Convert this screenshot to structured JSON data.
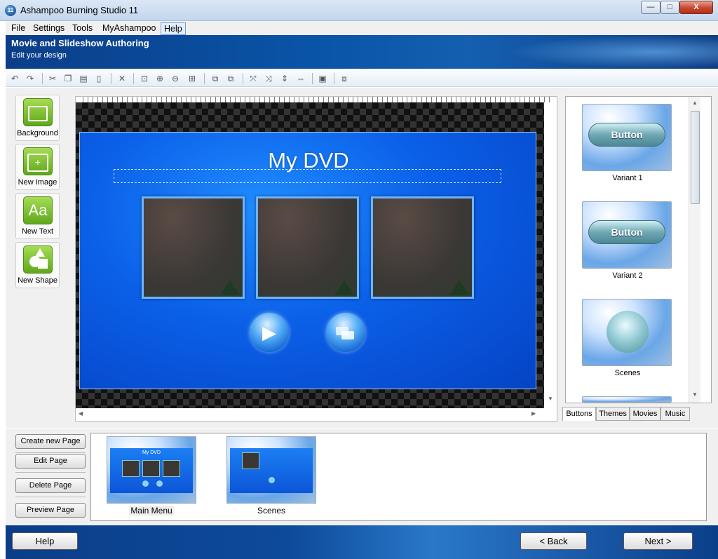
{
  "window": {
    "title": "Ashampoo Burning Studio 11",
    "app_icon_text": "11",
    "minimize_glyph": "—",
    "maximize_glyph": "□",
    "close_glyph": "X"
  },
  "menu": [
    "File",
    "Settings",
    "Tools",
    "MyAshampoo",
    "Help"
  ],
  "header": {
    "title": "Movie and Slideshow Authoring",
    "subtitle": "Edit your design"
  },
  "tools": [
    {
      "label": "Background",
      "icon": "background-icon"
    },
    {
      "label": "New Image",
      "icon": "new-image-icon"
    },
    {
      "label": "New Text",
      "icon": "new-text-icon",
      "glyph": "Aa"
    },
    {
      "label": "New Shape",
      "icon": "new-shape-icon"
    }
  ],
  "canvas": {
    "menu_title": "My DVD",
    "play_glyph": "▶"
  },
  "variants": [
    {
      "label": "Variant 1",
      "button_text": "Button"
    },
    {
      "label": "Variant 2",
      "button_text": "Button"
    },
    {
      "label": "Scenes",
      "button_text": ""
    }
  ],
  "tabs": [
    "Buttons",
    "Themes",
    "Movies",
    "Music"
  ],
  "page_buttons": [
    "Create new Page",
    "Edit Page",
    "Delete Page",
    "Preview Page"
  ],
  "pages": [
    {
      "label": "Main Menu",
      "mini_title": "My DVD"
    },
    {
      "label": "Scenes"
    }
  ],
  "footer": {
    "help": "Help",
    "back": "< Back",
    "next": "Next >"
  }
}
